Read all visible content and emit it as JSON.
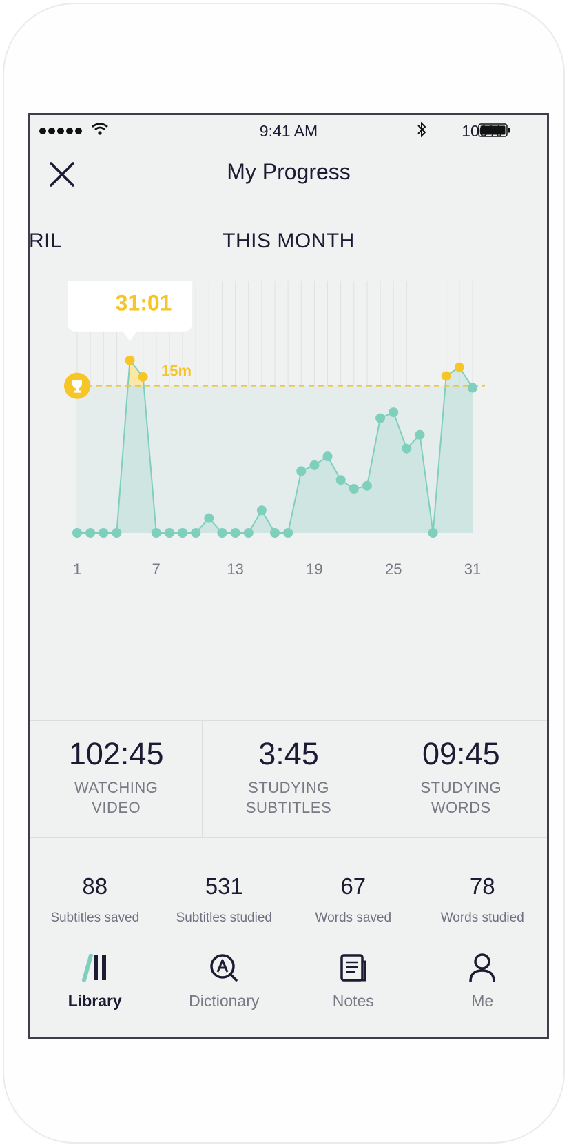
{
  "status_bar": {
    "time": "9:41 AM",
    "battery": "100%"
  },
  "header": {
    "title": "My Progress"
  },
  "period": {
    "prev_label": "RIL",
    "current_label": "THIS MONTH"
  },
  "colors": {
    "accent_teal": "#7fcfbd",
    "goal_yellow": "#f6c527",
    "text_dark": "#1c1b33",
    "text_muted": "#777984"
  },
  "chart_data": {
    "type": "line",
    "x": [
      1,
      2,
      3,
      4,
      5,
      6,
      7,
      8,
      9,
      10,
      11,
      12,
      13,
      14,
      15,
      16,
      17,
      18,
      19,
      20,
      21,
      22,
      23,
      24,
      25,
      26,
      27,
      28,
      29,
      30,
      31
    ],
    "values": [
      0,
      0,
      0,
      0,
      17.6,
      15.9,
      0,
      0,
      0,
      0,
      1.5,
      0,
      0,
      0,
      2.3,
      0,
      0,
      6.3,
      6.9,
      7.8,
      5.4,
      4.5,
      4.8,
      11.7,
      12.3,
      8.6,
      10.0,
      0,
      16.0,
      16.9,
      14.8
    ],
    "x_ticks": [
      "1",
      "7",
      "13",
      "19",
      "25",
      "31"
    ],
    "goal_label": "15m",
    "goal_value": 15,
    "highlight_label": "31:01",
    "ylim": [
      0,
      21
    ]
  },
  "stats": [
    {
      "value": "102:45",
      "label_line1": "WATCHING",
      "label_line2": "VIDEO"
    },
    {
      "value": "3:45",
      "label_line1": "STUDYING",
      "label_line2": "SUBTITLES"
    },
    {
      "value": "09:45",
      "label_line1": "STUDYING",
      "label_line2": "WORDS"
    }
  ],
  "counts": [
    {
      "value": "88",
      "label": "Subtitles saved"
    },
    {
      "value": "531",
      "label": "Subtitles studied"
    },
    {
      "value": "67",
      "label": "Words saved"
    },
    {
      "value": "78",
      "label": "Words studied"
    }
  ],
  "tabs": [
    {
      "label": "Library",
      "icon": "library-icon",
      "active": true
    },
    {
      "label": "Dictionary",
      "icon": "dictionary-icon",
      "active": false
    },
    {
      "label": "Notes",
      "icon": "notes-icon",
      "active": false
    },
    {
      "label": "Me",
      "icon": "profile-icon",
      "active": false
    }
  ]
}
